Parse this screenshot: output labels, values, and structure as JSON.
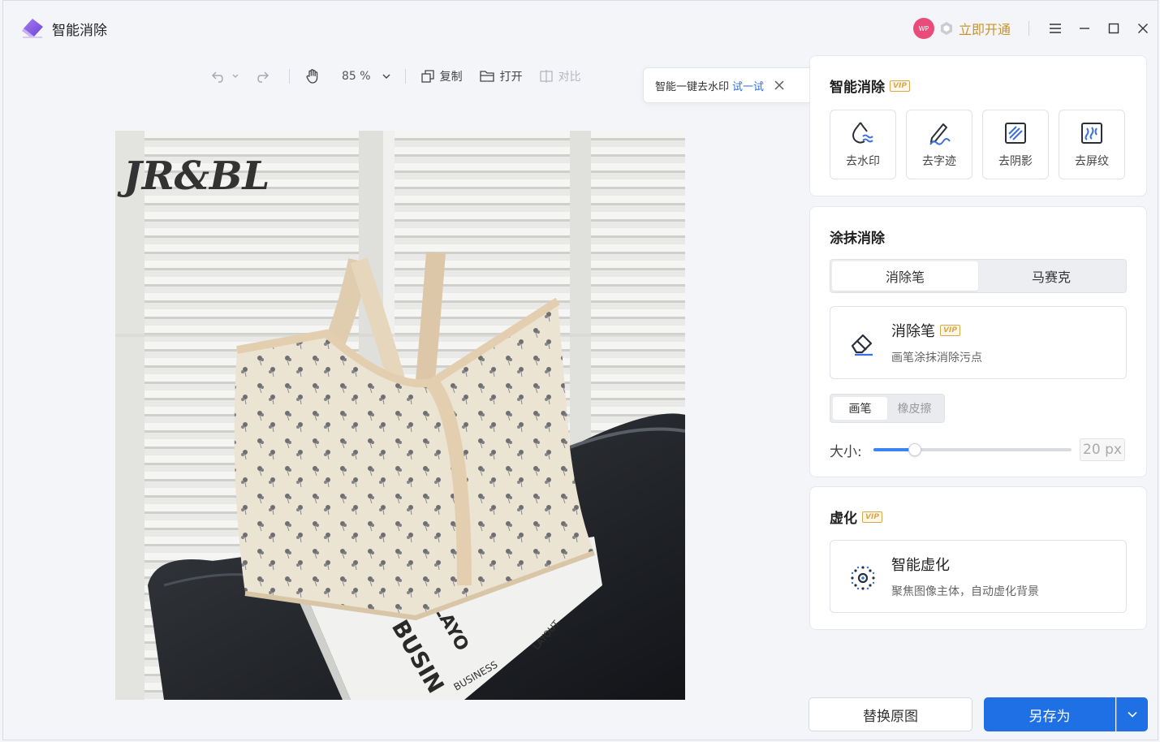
{
  "app": {
    "title": "智能消除",
    "avatar_text": "WP",
    "open_vip_label": "立即开通"
  },
  "toolbar": {
    "zoom": "85 %",
    "copy_label": "复制",
    "open_label": "打开",
    "compare_label": "对比"
  },
  "tip": {
    "text": "智能一键去水印",
    "action": "试一试"
  },
  "photo": {
    "watermark": "JR&BL",
    "book_text_1": "BUSIN",
    "book_text_2": "LAYO",
    "book_text_3": "BUSINESS",
    "book_text_4": "LAYOUT"
  },
  "smart_remove": {
    "title": "智能消除",
    "vip_badge": "VIP",
    "tools": [
      {
        "label": "去水印",
        "icon": "watermark-remove-icon"
      },
      {
        "label": "去字迹",
        "icon": "handwriting-remove-icon"
      },
      {
        "label": "去阴影",
        "icon": "shadow-remove-icon"
      },
      {
        "label": "去屏纹",
        "icon": "moire-remove-icon"
      }
    ]
  },
  "smear": {
    "title": "涂抹消除",
    "modes": [
      "消除笔",
      "马赛克"
    ],
    "active_mode": 0,
    "feature": {
      "name": "消除笔",
      "vip_badge": "VIP",
      "desc": "画笔涂抹消除污点"
    },
    "brush_modes": [
      "画笔",
      "橡皮擦"
    ],
    "active_brush": 0,
    "size_label": "大小:",
    "size_value": 20,
    "size_unit": "px",
    "size_display": "20 px",
    "size_fraction": 0.21
  },
  "blur": {
    "title": "虚化",
    "vip_badge": "VIP",
    "feature": {
      "name": "智能虚化",
      "desc": "聚焦图像主体，自动虚化背景"
    }
  },
  "actions": {
    "replace_label": "替换原图",
    "save_label": "另存为"
  },
  "colors": {
    "accent": "#1f6fe5",
    "vip_gold": "#c8932a",
    "slider": "#3b82f6"
  }
}
